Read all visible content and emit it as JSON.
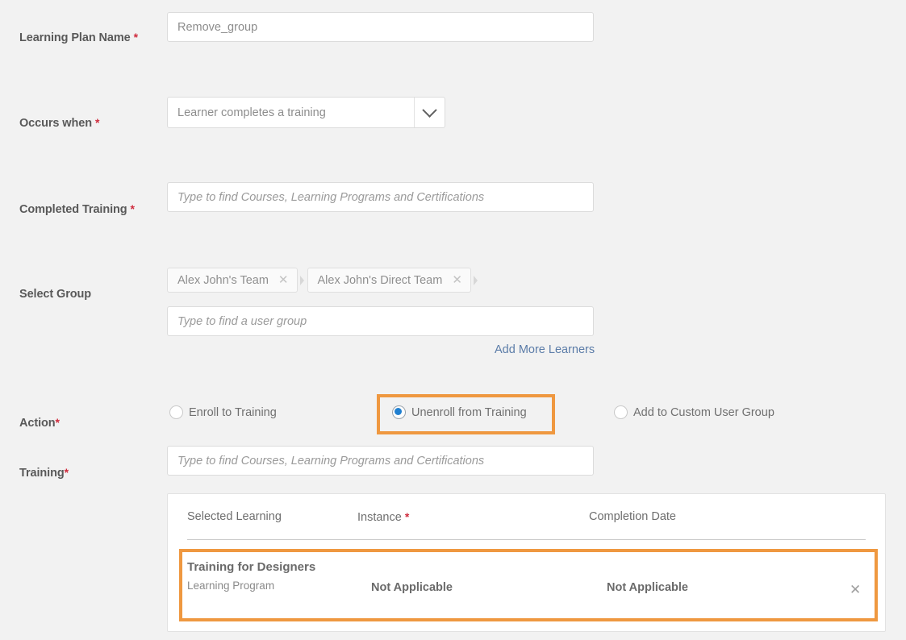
{
  "form": {
    "fields": {
      "learning_plan_name": {
        "label": "Learning Plan Name",
        "required_marker": "*",
        "value": "Remove_group"
      },
      "occurs_when": {
        "label": "Occurs when",
        "required_marker": "*",
        "selected": "Learner completes a training",
        "chevron_icon": "chevron-down-icon"
      },
      "completed_training": {
        "label": "Completed Training",
        "required_marker": "*",
        "placeholder": "Type to find Courses, Learning Programs and Certifications"
      },
      "select_group": {
        "label": "Select Group",
        "required_marker": "",
        "placeholder": "Type to find a user group",
        "chips": [
          {
            "label": "Alex John's Team",
            "remove_icon": "close-icon"
          },
          {
            "label": "Alex John's Direct Team",
            "remove_icon": "close-icon"
          }
        ],
        "add_more_link": "Add More Learners"
      },
      "action": {
        "label": "Action",
        "required_marker": "*",
        "options": [
          {
            "label": "Enroll to Training",
            "selected": false
          },
          {
            "label": "Unenroll from Training",
            "selected": true
          },
          {
            "label": "Add to Custom User Group",
            "selected": false
          }
        ],
        "selected_value": "Unenroll from Training"
      },
      "training": {
        "label": "Training",
        "required_marker": "*",
        "placeholder": "Type to find Courses, Learning Programs and Certifications"
      }
    },
    "selected_learning_table": {
      "columns": [
        {
          "label": "Selected Learning",
          "required_marker": ""
        },
        {
          "label": "Instance",
          "required_marker": "*"
        },
        {
          "label": "Completion Date",
          "required_marker": ""
        }
      ],
      "rows": [
        {
          "name": "Training for Designers",
          "type": "Learning Program",
          "instance": "Not Applicable",
          "completion_date": "Not Applicable",
          "remove_icon": "close-icon"
        }
      ]
    },
    "highlights": {
      "accent_color": "#ef9840",
      "targets": [
        "Unenroll from Training",
        "Training for Designers row"
      ]
    }
  },
  "colors": {
    "page_background": "#f2f2f2",
    "card_background": "#ffffff",
    "label_text": "#595959",
    "placeholder_text": "#9a9a9a",
    "required_asterisk": "#cf2b3d",
    "link_blue": "#5b7ca8",
    "radio_selected_blue": "#1f7fd0",
    "highlight_orange": "#ef9840",
    "border": "#dcdcdc"
  }
}
